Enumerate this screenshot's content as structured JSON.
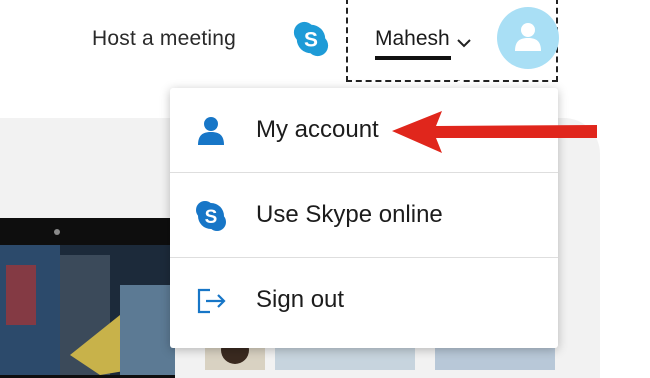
{
  "header": {
    "host_meeting_label": "Host a meeting",
    "user_name": "Mahesh"
  },
  "menu": {
    "items": [
      {
        "label": "My account",
        "icon": "person-icon"
      },
      {
        "label": "Use Skype online",
        "icon": "skype-icon"
      },
      {
        "label": "Sign out",
        "icon": "sign-out-icon"
      }
    ]
  },
  "colors": {
    "skype_blue": "#1e9bd7",
    "avatar_bg": "#a9dff5",
    "icon_blue": "#1776c7",
    "annotation_red": "#e0261c"
  }
}
